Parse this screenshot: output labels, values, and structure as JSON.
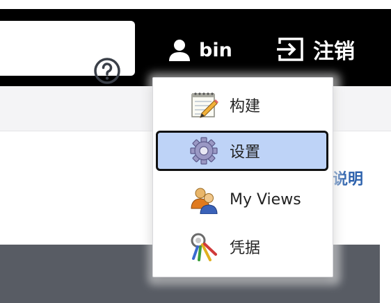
{
  "header": {
    "user_name": "bin",
    "logout_label": "注销",
    "icons": [
      "help-icon",
      "user-icon",
      "logout-icon"
    ]
  },
  "page": {
    "help_link": "说明"
  },
  "dropdown": {
    "items": [
      {
        "label": "构建",
        "icon": "notepad-icon",
        "selected": false
      },
      {
        "label": "设置",
        "icon": "gear-icon",
        "selected": true
      },
      {
        "label": "My Views",
        "icon": "users-icon",
        "selected": false
      },
      {
        "label": "凭据",
        "icon": "keys-icon",
        "selected": false
      }
    ]
  },
  "colors": {
    "header_bg": "#000000",
    "selected_bg": "#bed3f7",
    "link": "#2d62ad",
    "panel": "#585c64"
  }
}
